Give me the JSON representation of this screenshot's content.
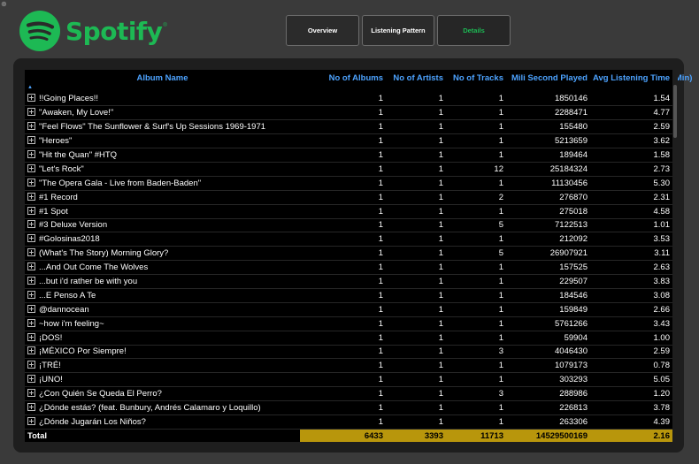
{
  "corner_mark": "⊕",
  "brand": {
    "name": "Spotify",
    "tm": "®",
    "color": "#1DB954"
  },
  "tabs": [
    {
      "label": "Overview",
      "active": false
    },
    {
      "label": "Listening Pattern",
      "active": false
    },
    {
      "label": "Details",
      "active": true
    }
  ],
  "table": {
    "columns": [
      "Album Name",
      "No of Albums",
      "No of Artists",
      "No of Tracks",
      "Mili Second Played",
      "Avg Listening Time (Min)"
    ],
    "sort_indicator": "▲",
    "rows": [
      {
        "name": "!!Going Places!!",
        "albums": "1",
        "artists": "1",
        "tracks": "1",
        "ms": "1850146",
        "avg": "1.54"
      },
      {
        "name": "\"Awaken, My Love!\"",
        "albums": "1",
        "artists": "1",
        "tracks": "1",
        "ms": "2288471",
        "avg": "4.77"
      },
      {
        "name": "\"Feel Flows\" The Sunflower & Surf's Up Sessions 1969-1971",
        "albums": "1",
        "artists": "1",
        "tracks": "1",
        "ms": "155480",
        "avg": "2.59"
      },
      {
        "name": "\"Heroes\"",
        "albums": "1",
        "artists": "1",
        "tracks": "1",
        "ms": "5213659",
        "avg": "3.62"
      },
      {
        "name": "\"Hit the Quan\" #HTQ",
        "albums": "1",
        "artists": "1",
        "tracks": "1",
        "ms": "189464",
        "avg": "1.58"
      },
      {
        "name": "\"Let's Rock\"",
        "albums": "1",
        "artists": "1",
        "tracks": "12",
        "ms": "25184324",
        "avg": "2.73"
      },
      {
        "name": "\"The Opera Gala - Live from Baden-Baden\"",
        "albums": "1",
        "artists": "1",
        "tracks": "1",
        "ms": "11130456",
        "avg": "5.30"
      },
      {
        "name": "#1 Record",
        "albums": "1",
        "artists": "1",
        "tracks": "2",
        "ms": "276870",
        "avg": "2.31"
      },
      {
        "name": "#1 Spot",
        "albums": "1",
        "artists": "1",
        "tracks": "1",
        "ms": "275018",
        "avg": "4.58"
      },
      {
        "name": "#3 Deluxe Version",
        "albums": "1",
        "artists": "1",
        "tracks": "5",
        "ms": "7122513",
        "avg": "1.01"
      },
      {
        "name": "#Golosinas2018",
        "albums": "1",
        "artists": "1",
        "tracks": "1",
        "ms": "212092",
        "avg": "3.53"
      },
      {
        "name": "(What's The Story) Morning Glory?",
        "albums": "1",
        "artists": "1",
        "tracks": "5",
        "ms": "26907921",
        "avg": "3.11"
      },
      {
        "name": "...And Out Come The Wolves",
        "albums": "1",
        "artists": "1",
        "tracks": "1",
        "ms": "157525",
        "avg": "2.63"
      },
      {
        "name": "...but i'd rather be with you",
        "albums": "1",
        "artists": "1",
        "tracks": "1",
        "ms": "229507",
        "avg": "3.83"
      },
      {
        "name": "...E Penso A Te",
        "albums": "1",
        "artists": "1",
        "tracks": "1",
        "ms": "184546",
        "avg": "3.08"
      },
      {
        "name": "@dannocean",
        "albums": "1",
        "artists": "1",
        "tracks": "1",
        "ms": "159849",
        "avg": "2.66"
      },
      {
        "name": "~how i'm feeling~",
        "albums": "1",
        "artists": "1",
        "tracks": "1",
        "ms": "5761266",
        "avg": "3.43"
      },
      {
        "name": "¡DOS!",
        "albums": "1",
        "artists": "1",
        "tracks": "1",
        "ms": "59904",
        "avg": "1.00"
      },
      {
        "name": "¡MÉXICO Por Siempre!",
        "albums": "1",
        "artists": "1",
        "tracks": "3",
        "ms": "4046430",
        "avg": "2.59"
      },
      {
        "name": "¡TRÉ!",
        "albums": "1",
        "artists": "1",
        "tracks": "1",
        "ms": "1079173",
        "avg": "0.78"
      },
      {
        "name": "¡UNO!",
        "albums": "1",
        "artists": "1",
        "tracks": "1",
        "ms": "303293",
        "avg": "5.05"
      },
      {
        "name": "¿Con Quién Se Queda El Perro?",
        "albums": "1",
        "artists": "1",
        "tracks": "3",
        "ms": "288986",
        "avg": "1.20"
      },
      {
        "name": "¿Dónde estás? (feat. Bunbury, Andrés Calamaro y Loquillo)",
        "albums": "1",
        "artists": "1",
        "tracks": "1",
        "ms": "226813",
        "avg": "3.78"
      },
      {
        "name": "¿Dónde Jugarán Los Niños?",
        "albums": "1",
        "artists": "1",
        "tracks": "1",
        "ms": "263306",
        "avg": "4.39"
      }
    ],
    "total": {
      "label": "Total",
      "albums": "6433",
      "artists": "3393",
      "tracks": "11713",
      "ms": "14529500169",
      "avg": "2.16"
    },
    "colors": {
      "header_text": "#4da3ff",
      "total_bg": "#b8960c"
    }
  }
}
